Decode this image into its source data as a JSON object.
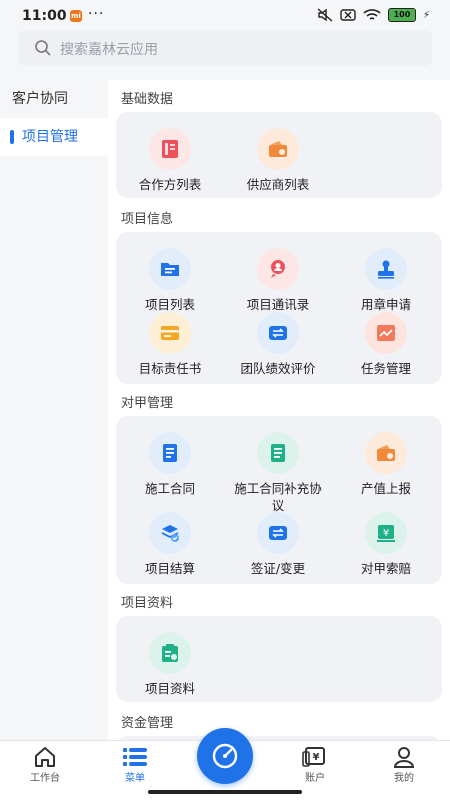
{
  "status": {
    "time": "11:00",
    "battery": "100"
  },
  "search": {
    "placeholder": "搜索嘉林云应用"
  },
  "sidebar": {
    "items": [
      {
        "label": "客户协同"
      },
      {
        "label": "项目管理"
      }
    ]
  },
  "sections": [
    {
      "title": "基础数据",
      "items": [
        {
          "label": "合作方列表"
        },
        {
          "label": "供应商列表"
        }
      ]
    },
    {
      "title": "项目信息",
      "items": [
        {
          "label": "项目列表"
        },
        {
          "label": "项目通讯录"
        },
        {
          "label": "用章申请"
        },
        {
          "label": "目标责任书"
        },
        {
          "label": "团队绩效评价"
        },
        {
          "label": "任务管理"
        }
      ]
    },
    {
      "title": "对甲管理",
      "items": [
        {
          "label": "施工合同"
        },
        {
          "label": "施工合同补充协议"
        },
        {
          "label": "产值上报"
        },
        {
          "label": "项目结算"
        },
        {
          "label": "签证/变更"
        },
        {
          "label": "对甲索赔"
        }
      ]
    },
    {
      "title": "项目资料",
      "items": [
        {
          "label": "项目资料"
        }
      ]
    },
    {
      "title": "资金管理",
      "items": []
    }
  ],
  "tabbar": {
    "items": [
      {
        "label": "工作台"
      },
      {
        "label": "菜单"
      },
      {
        "label": "账户"
      },
      {
        "label": "我的"
      }
    ]
  },
  "colors": {
    "accent": "#1f72e8",
    "red": "#f0505a",
    "orange": "#f08a3a",
    "green": "#1fb08a"
  }
}
